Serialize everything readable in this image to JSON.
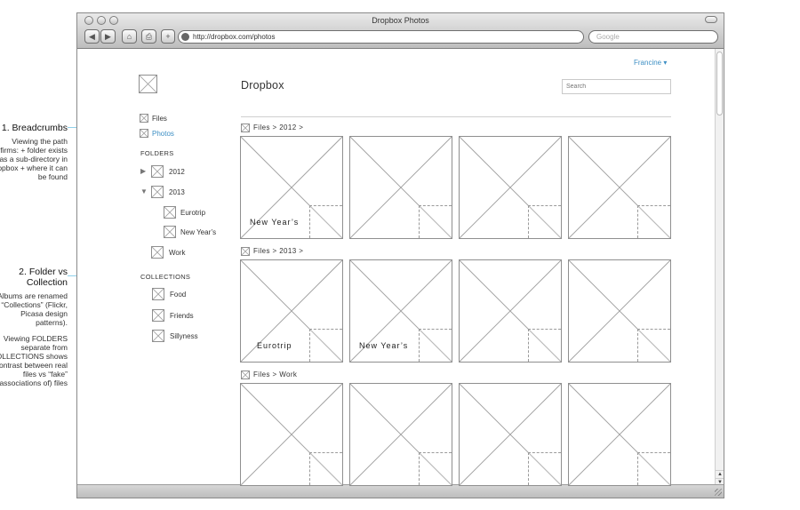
{
  "annotations": [
    {
      "title": "1. Breadcrumbs",
      "body": [
        "Viewing the path confirms: + folder exists as a sub-directory in Dropbox + where it can be found"
      ]
    },
    {
      "title": "2. Folder vs Collection",
      "body": [
        "Albums are renamed as “Collections” (Flickr, Picasa design patterns).",
        "Viewing FOLDERS separate from COLLECTIONS shows contrast between real files vs “fake” (associations of) files"
      ]
    }
  ],
  "browser": {
    "title": "Dropbox Photos",
    "url": "http://dropbox.com/photos",
    "search_placeholder": "Google",
    "buttons": {
      "back": "◀",
      "forward": "▶",
      "home": "⌂",
      "print": "⎙",
      "add": "+"
    },
    "scroll": {
      "up": "▲",
      "down": "▼"
    }
  },
  "header": {
    "user_menu": "Francine ▾",
    "title": "Dropbox",
    "search_placeholder": "Search"
  },
  "sidebar": {
    "files": "Files",
    "photos": "Photos",
    "folders_heading": "FOLDERS",
    "folders": [
      {
        "label": "2012",
        "toggle": "▶"
      },
      {
        "label": "2013",
        "toggle": "▼"
      },
      {
        "label": "Eurotrip"
      },
      {
        "label": "New Year’s"
      },
      {
        "label": "Work"
      }
    ],
    "collections_heading": "COLLECTIONS",
    "collections": [
      "Food",
      "Friends",
      "Sillyness"
    ]
  },
  "sections": [
    {
      "breadcrumb": "Files > 2012 >",
      "tiles": [
        "New Year’s",
        "",
        "",
        ""
      ]
    },
    {
      "breadcrumb": "Files > 2013 >",
      "tiles": [
        "Eurotrip",
        "New Year’s",
        "",
        ""
      ]
    },
    {
      "breadcrumb": "Files > Work",
      "tiles": [
        "",
        "",
        "",
        ""
      ]
    }
  ]
}
